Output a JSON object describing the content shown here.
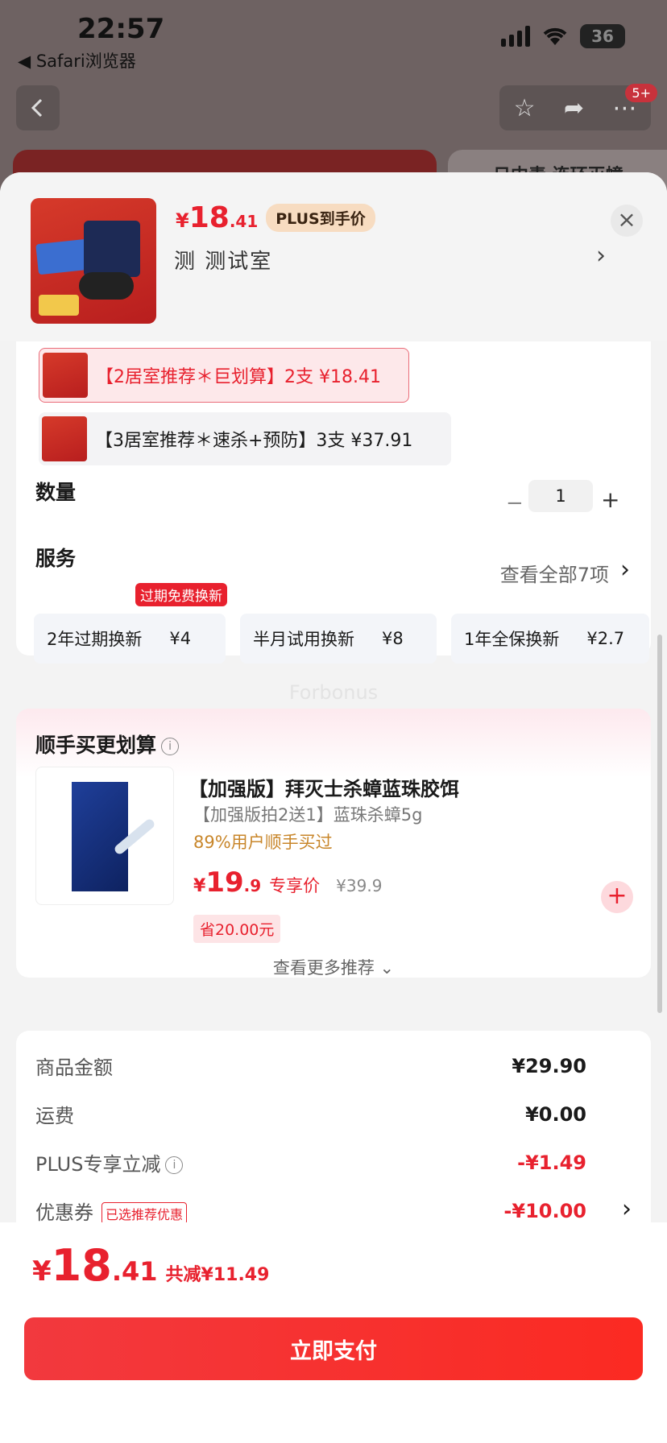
{
  "status_bar": {
    "time": "22:57",
    "back_app": "◀ Safari浏览器",
    "battery": "36"
  },
  "nav": {
    "badge": "5+"
  },
  "background": {
    "right_banner_text": "一日中毒 连环灭蟑"
  },
  "product": {
    "price_yen": "¥",
    "price_int": "18",
    "price_dec": ".41",
    "plus_label": "PLUS到手价",
    "selected_spec": "测  测试室"
  },
  "variants": [
    {
      "label": "【2居室推荐＊巨划算】2支  ¥18.41",
      "selected": true
    },
    {
      "label": "【3居室推荐＊速杀+预防】3支  ¥37.91",
      "selected": false
    }
  ],
  "quantity": {
    "label": "数量",
    "value": "1",
    "minus": "−",
    "plus": "+"
  },
  "services": {
    "label": "服务",
    "view_all": "查看全部7项",
    "tag": "过期免费换新",
    "items": [
      {
        "name": "2年过期换新",
        "price": "¥4"
      },
      {
        "name": "半月试用换新",
        "price": "¥8"
      },
      {
        "name": "1年全保换新",
        "price": "¥2.7"
      }
    ]
  },
  "watermark": "Forbonus",
  "addon": {
    "title": "顺手买更划算",
    "name": "【加强版】拜灭士杀蟑蓝珠胶饵",
    "sub": "【加强版拍2送1】蓝珠杀蟑5g",
    "bought": "89%用户顺手买过",
    "price_yen": "¥",
    "price_int": "19",
    "price_dec": ".9",
    "price_label": "专享价",
    "orig_price": "¥39.9",
    "save": "省20.00元",
    "more": "查看更多推荐 ⌄"
  },
  "fees": [
    {
      "key": "商品金额",
      "value": "¥29.90",
      "red": false
    },
    {
      "key": "运费",
      "value": "¥0.00",
      "red": false
    },
    {
      "key": "PLUS专享立减",
      "value": "-¥1.49",
      "red": true
    },
    {
      "key": "优惠券",
      "value": "-¥10.00",
      "red": true,
      "tag": "已选推荐优惠"
    }
  ],
  "footer": {
    "yen": "¥",
    "int": "18",
    "dec": ".41",
    "saved": "共减¥11.49",
    "pay_label": "立即支付"
  },
  "colors": {
    "accent": "#e8212e",
    "plus_gold": "#f7dcc1"
  }
}
